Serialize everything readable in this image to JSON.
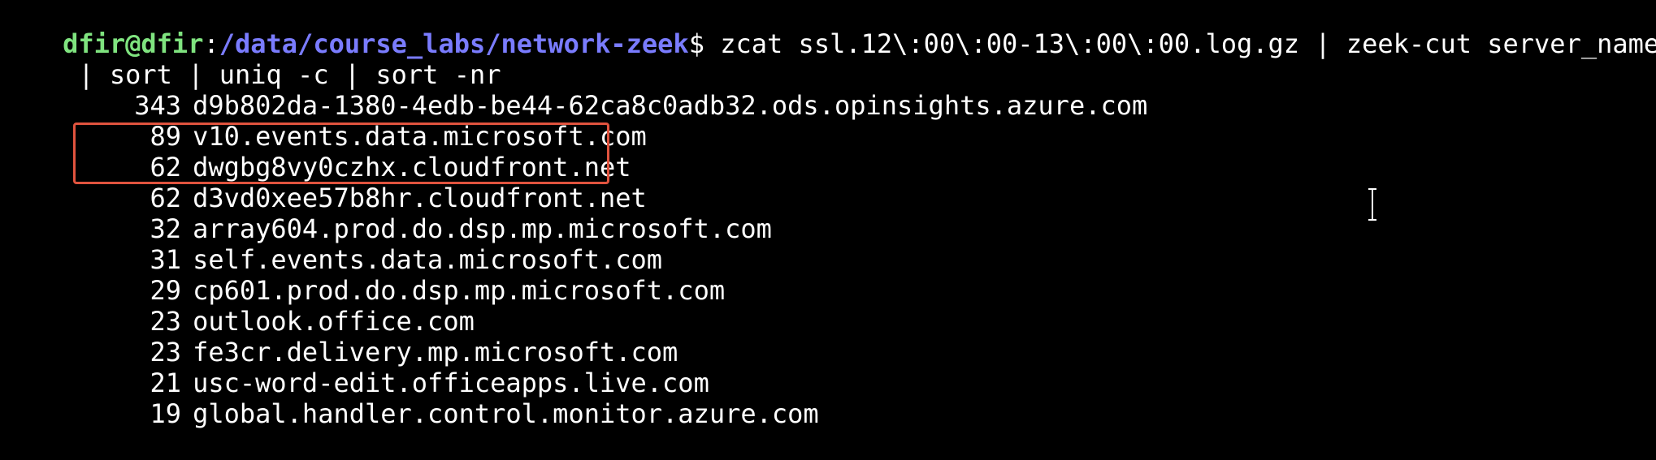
{
  "prompt": {
    "user_host": "dfir@dfir",
    "separator": ":",
    "path": "/data/course_labs/network-zeek",
    "dollar": "$ ",
    "command_line1": "zcat ssl.12\\:00\\:00-13\\:00\\:00.log.gz | zeek-cut server_name",
    "command_line2": " | sort | uniq -c | sort -nr"
  },
  "results": [
    {
      "count": "343",
      "domain": "d9b802da-1380-4edb-be44-62ca8c0adb32.ods.opinsights.azure.com"
    },
    {
      "count": "89",
      "domain": "v10.events.data.microsoft.com"
    },
    {
      "count": "62",
      "domain": "dwgbg8vy0czhx.cloudfront.net"
    },
    {
      "count": "62",
      "domain": "d3vd0xee57b8hr.cloudfront.net"
    },
    {
      "count": "32",
      "domain": "array604.prod.do.dsp.mp.microsoft.com"
    },
    {
      "count": "31",
      "domain": "self.events.data.microsoft.com"
    },
    {
      "count": "29",
      "domain": "cp601.prod.do.dsp.mp.microsoft.com"
    },
    {
      "count": "23",
      "domain": "outlook.office.com"
    },
    {
      "count": "23",
      "domain": "fe3cr.delivery.mp.microsoft.com"
    },
    {
      "count": "21",
      "domain": "usc-word-edit.officeapps.live.com"
    },
    {
      "count": "19",
      "domain": "global.handler.control.monitor.azure.com"
    }
  ],
  "colors": {
    "background": "#000000",
    "user_host": "#7fe37f",
    "path": "#7a7cff",
    "text": "#ffffff",
    "highlight": "#e0533e"
  },
  "icons": {
    "cursor": "i-beam-cursor-icon"
  }
}
